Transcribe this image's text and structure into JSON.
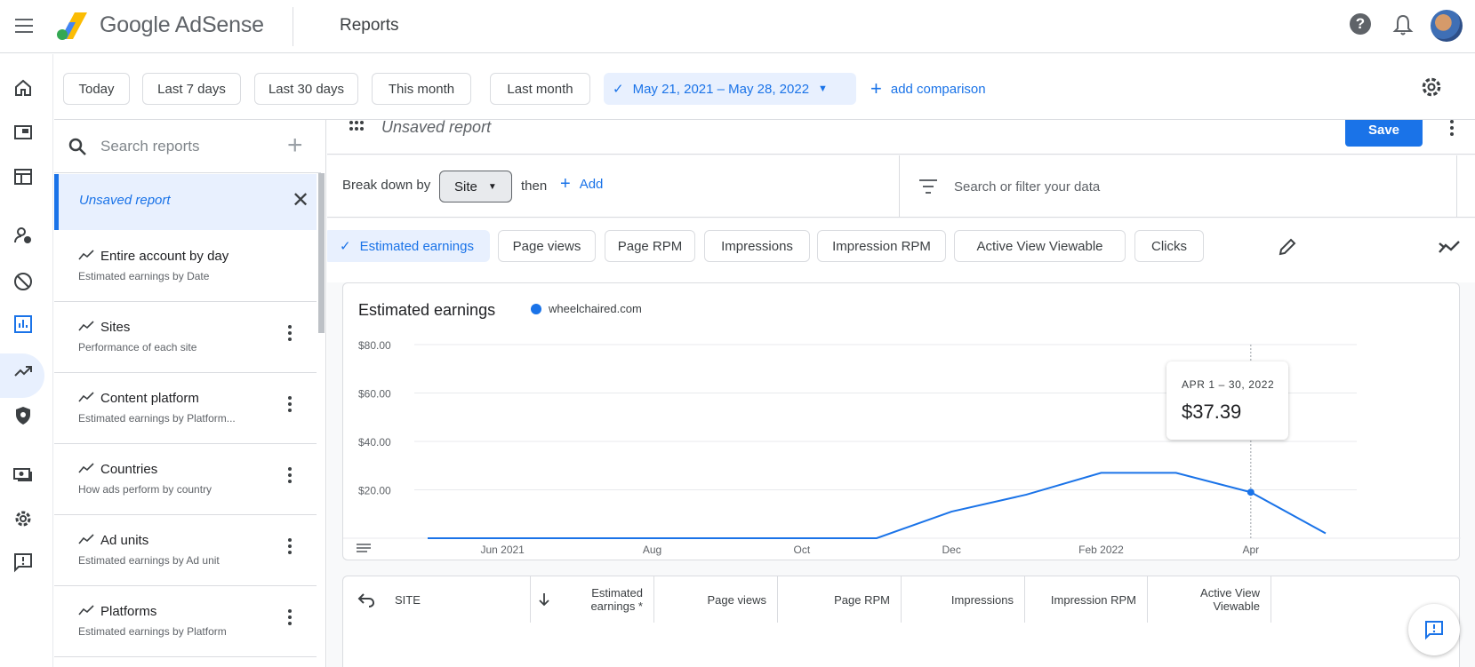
{
  "header": {
    "brand": "Google AdSense",
    "section_title": "Reports",
    "help_glyph": "?"
  },
  "date_presets": [
    "Today",
    "Last 7 days",
    "Last 30 days",
    "This month",
    "Last month"
  ],
  "date_range": {
    "label": "May 21, 2021 – May 28, 2022",
    "add_comparison": "add comparison"
  },
  "sidebar": {
    "search_placeholder": "Search reports",
    "unsaved": "Unsaved report",
    "reports": [
      {
        "title": "Entire account by day",
        "subtitle": "Estimated earnings by Date"
      },
      {
        "title": "Sites",
        "subtitle": "Performance of each site"
      },
      {
        "title": "Content platform",
        "subtitle": "Estimated earnings by Platform..."
      },
      {
        "title": "Countries",
        "subtitle": "How ads perform by country"
      },
      {
        "title": "Ad units",
        "subtitle": "Estimated earnings by Ad unit"
      },
      {
        "title": "Platforms",
        "subtitle": "Estimated earnings by Platform"
      }
    ]
  },
  "report": {
    "name": "Unsaved report",
    "save_label": "Save",
    "breakdown_label": "Break down by",
    "breakdown_value": "Site",
    "then_label": "then",
    "add_label": "Add",
    "filter_placeholder": "Search or filter your data"
  },
  "metrics": [
    "Estimated earnings",
    "Page views",
    "Page RPM",
    "Impressions",
    "Impression RPM",
    "Active View Viewable",
    "Clicks"
  ],
  "tooltip": {
    "date": "APR 1 – 30, 2022",
    "value": "$37.39"
  },
  "chart_data": {
    "type": "line",
    "title": "Estimated earnings",
    "legend": "wheelchaired.com",
    "series": [
      {
        "name": "wheelchaired.com",
        "color": "#1a73e8",
        "values": [
          0,
          0,
          0,
          0,
          0,
          0,
          0,
          11,
          18,
          27,
          27,
          19,
          2
        ]
      }
    ],
    "x": [
      "2021-05",
      "2021-06",
      "2021-07",
      "2021-08",
      "2021-09",
      "2021-10",
      "2021-11",
      "2021-12",
      "2022-01",
      "2022-02",
      "2022-03",
      "2022-04",
      "2022-05"
    ],
    "x_ticks": [
      "Jun 2021",
      "Aug",
      "Oct",
      "Dec",
      "Feb 2022",
      "Apr"
    ],
    "y_ticks": [
      "$80.00",
      "$60.00",
      "$40.00",
      "$20.00"
    ],
    "ylim": [
      0,
      80
    ],
    "grid": true
  },
  "table": {
    "headers": [
      "SITE",
      "Estimated earnings *",
      "Page views",
      "Page RPM",
      "Impressions",
      "Impression RPM",
      "Active View Viewable"
    ]
  },
  "colors": {
    "accent": "#1a73e8"
  }
}
